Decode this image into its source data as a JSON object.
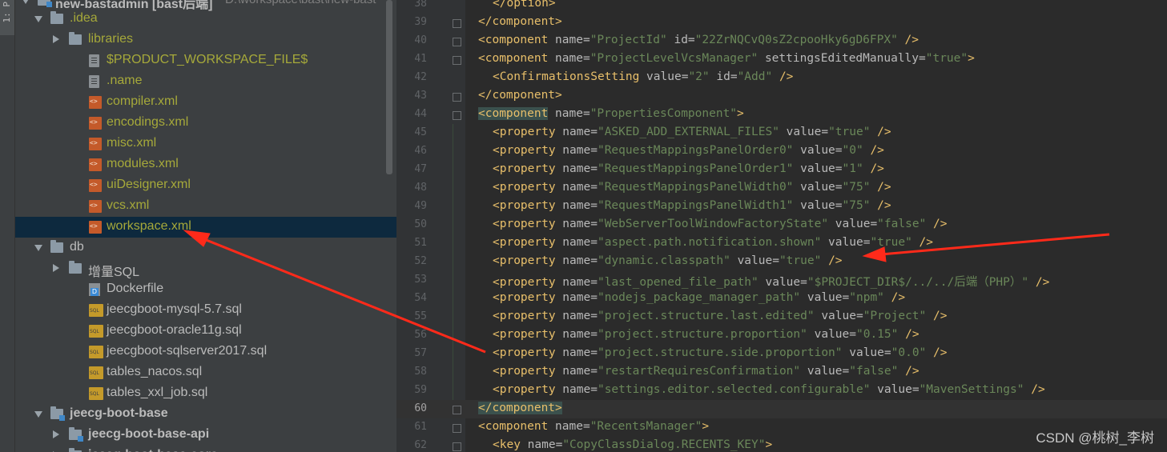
{
  "tool_window_tab": "1: P",
  "project_tree": {
    "root": {
      "label": "new-bastadmin [bast后端]",
      "path": "D:\\workspace\\bast\\new-bast"
    },
    "items": [
      {
        "label": ".idea",
        "kind": "folder",
        "expanded": true,
        "color": "yellow"
      },
      {
        "label": "libraries",
        "kind": "folder",
        "expanded": false,
        "color": "yellow"
      },
      {
        "label": "$PRODUCT_WORKSPACE_FILE$",
        "kind": "text-file",
        "color": "yellow"
      },
      {
        "label": ".name",
        "kind": "text-file",
        "color": "yellow"
      },
      {
        "label": "compiler.xml",
        "kind": "xml-file",
        "color": "yellow"
      },
      {
        "label": "encodings.xml",
        "kind": "xml-file",
        "color": "yellow"
      },
      {
        "label": "misc.xml",
        "kind": "xml-file",
        "color": "yellow"
      },
      {
        "label": "modules.xml",
        "kind": "xml-file",
        "color": "yellow"
      },
      {
        "label": "uiDesigner.xml",
        "kind": "xml-file",
        "color": "yellow"
      },
      {
        "label": "vcs.xml",
        "kind": "xml-file",
        "color": "yellow"
      },
      {
        "label": "workspace.xml",
        "kind": "xml-file",
        "color": "yellow",
        "selected": true
      },
      {
        "label": "db",
        "kind": "folder",
        "expanded": true,
        "color": "gray"
      },
      {
        "label": "增量SQL",
        "kind": "folder",
        "expanded": false,
        "color": "gray"
      },
      {
        "label": "Dockerfile",
        "kind": "docker-file",
        "color": "gray"
      },
      {
        "label": "jeecgboot-mysql-5.7.sql",
        "kind": "sql-file",
        "color": "gray"
      },
      {
        "label": "jeecgboot-oracle11g.sql",
        "kind": "sql-file",
        "color": "gray"
      },
      {
        "label": "jeecgboot-sqlserver2017.sql",
        "kind": "sql-file",
        "color": "gray"
      },
      {
        "label": "tables_nacos.sql",
        "kind": "sql-file",
        "color": "gray"
      },
      {
        "label": "tables_xxl_job.sql",
        "kind": "sql-file",
        "color": "gray"
      },
      {
        "label": "jeecg-boot-base",
        "kind": "module-folder",
        "expanded": true,
        "color": "bold"
      },
      {
        "label": "jeecg-boot-base-api",
        "kind": "module-folder",
        "expanded": false,
        "color": "bold"
      },
      {
        "label": "jeecg-boot-base-core",
        "kind": "module-folder",
        "expanded": false,
        "color": "bold"
      }
    ]
  },
  "editor": {
    "current_line": 60,
    "lines": [
      {
        "n": 38,
        "indent": 2,
        "tokens": [
          [
            "t",
            "</option>"
          ]
        ]
      },
      {
        "n": 39,
        "indent": 0,
        "tokens": [
          [
            "t",
            "</component>"
          ]
        ]
      },
      {
        "n": 40,
        "indent": 0,
        "tokens": [
          [
            "t",
            "<component"
          ],
          [
            "a",
            " name="
          ],
          [
            "v",
            "\"ProjectId\""
          ],
          [
            "a",
            " id="
          ],
          [
            "v",
            "\"22ZrNQCvQ0sZ2cpooHky6gD6FPX\""
          ],
          [
            "t",
            " />"
          ]
        ]
      },
      {
        "n": 41,
        "indent": 0,
        "tokens": [
          [
            "t",
            "<component"
          ],
          [
            "a",
            " name="
          ],
          [
            "v",
            "\"ProjectLevelVcsManager\""
          ],
          [
            "a",
            " settingsEditedManually="
          ],
          [
            "v",
            "\"true\""
          ],
          [
            "t",
            ">"
          ]
        ]
      },
      {
        "n": 42,
        "indent": 2,
        "tokens": [
          [
            "t",
            "<ConfirmationsSetting"
          ],
          [
            "a",
            " value="
          ],
          [
            "v",
            "\"2\""
          ],
          [
            "a",
            " id="
          ],
          [
            "v",
            "\"Add\""
          ],
          [
            "t",
            " />"
          ]
        ]
      },
      {
        "n": 43,
        "indent": 0,
        "tokens": [
          [
            "t",
            "</component>"
          ]
        ]
      },
      {
        "n": 44,
        "indent": 0,
        "tokens": [
          [
            "th",
            "<component"
          ],
          [
            "a",
            " name="
          ],
          [
            "v",
            "\"PropertiesComponent\""
          ],
          [
            "t",
            ">"
          ]
        ]
      },
      {
        "n": 45,
        "indent": 2,
        "tokens": [
          [
            "t",
            "<property"
          ],
          [
            "a",
            " name="
          ],
          [
            "v",
            "\"ASKED_ADD_EXTERNAL_FILES\""
          ],
          [
            "a",
            " value="
          ],
          [
            "v",
            "\"true\""
          ],
          [
            "t",
            " />"
          ]
        ]
      },
      {
        "n": 46,
        "indent": 2,
        "tokens": [
          [
            "t",
            "<property"
          ],
          [
            "a",
            " name="
          ],
          [
            "v",
            "\"RequestMappingsPanelOrder0\""
          ],
          [
            "a",
            " value="
          ],
          [
            "v",
            "\"0\""
          ],
          [
            "t",
            " />"
          ]
        ]
      },
      {
        "n": 47,
        "indent": 2,
        "tokens": [
          [
            "t",
            "<property"
          ],
          [
            "a",
            " name="
          ],
          [
            "v",
            "\"RequestMappingsPanelOrder1\""
          ],
          [
            "a",
            " value="
          ],
          [
            "v",
            "\"1\""
          ],
          [
            "t",
            " />"
          ]
        ]
      },
      {
        "n": 48,
        "indent": 2,
        "tokens": [
          [
            "t",
            "<property"
          ],
          [
            "a",
            " name="
          ],
          [
            "v",
            "\"RequestMappingsPanelWidth0\""
          ],
          [
            "a",
            " value="
          ],
          [
            "v",
            "\"75\""
          ],
          [
            "t",
            " />"
          ]
        ]
      },
      {
        "n": 49,
        "indent": 2,
        "tokens": [
          [
            "t",
            "<property"
          ],
          [
            "a",
            " name="
          ],
          [
            "v",
            "\"RequestMappingsPanelWidth1\""
          ],
          [
            "a",
            " value="
          ],
          [
            "v",
            "\"75\""
          ],
          [
            "t",
            " />"
          ]
        ]
      },
      {
        "n": 50,
        "indent": 2,
        "tokens": [
          [
            "t",
            "<property"
          ],
          [
            "a",
            " name="
          ],
          [
            "v",
            "\"WebServerToolWindowFactoryState\""
          ],
          [
            "a",
            " value="
          ],
          [
            "v",
            "\"false\""
          ],
          [
            "t",
            " />"
          ]
        ]
      },
      {
        "n": 51,
        "indent": 2,
        "tokens": [
          [
            "t",
            "<property"
          ],
          [
            "a",
            " name="
          ],
          [
            "v",
            "\"aspect.path.notification.shown\""
          ],
          [
            "a",
            " value="
          ],
          [
            "v",
            "\"true\""
          ],
          [
            "t",
            " />"
          ]
        ]
      },
      {
        "n": 52,
        "indent": 2,
        "tokens": [
          [
            "t",
            "<property"
          ],
          [
            "a",
            " name="
          ],
          [
            "v",
            "\"dynamic.classpath\""
          ],
          [
            "a",
            " value="
          ],
          [
            "v",
            "\"true\""
          ],
          [
            "t",
            " />"
          ]
        ]
      },
      {
        "n": 53,
        "indent": 2,
        "tokens": [
          [
            "t",
            "<property"
          ],
          [
            "a",
            " name="
          ],
          [
            "v",
            "\"last_opened_file_path\""
          ],
          [
            "a",
            " value="
          ],
          [
            "v",
            "\"$PROJECT_DIR$/../../后端（PHP）\""
          ],
          [
            "t",
            " />"
          ]
        ]
      },
      {
        "n": 54,
        "indent": 2,
        "tokens": [
          [
            "t",
            "<property"
          ],
          [
            "a",
            " name="
          ],
          [
            "v",
            "\"nodejs_package_manager_path\""
          ],
          [
            "a",
            " value="
          ],
          [
            "v",
            "\"npm\""
          ],
          [
            "t",
            " />"
          ]
        ]
      },
      {
        "n": 55,
        "indent": 2,
        "tokens": [
          [
            "t",
            "<property"
          ],
          [
            "a",
            " name="
          ],
          [
            "v",
            "\"project.structure.last.edited\""
          ],
          [
            "a",
            " value="
          ],
          [
            "v",
            "\"Project\""
          ],
          [
            "t",
            " />"
          ]
        ]
      },
      {
        "n": 56,
        "indent": 2,
        "tokens": [
          [
            "t",
            "<property"
          ],
          [
            "a",
            " name="
          ],
          [
            "v",
            "\"project.structure.proportion\""
          ],
          [
            "a",
            " value="
          ],
          [
            "v",
            "\"0.15\""
          ],
          [
            "t",
            " />"
          ]
        ]
      },
      {
        "n": 57,
        "indent": 2,
        "tokens": [
          [
            "t",
            "<property"
          ],
          [
            "a",
            " name="
          ],
          [
            "v",
            "\"project.structure.side.proportion\""
          ],
          [
            "a",
            " value="
          ],
          [
            "v",
            "\"0.0\""
          ],
          [
            "t",
            " />"
          ]
        ]
      },
      {
        "n": 58,
        "indent": 2,
        "tokens": [
          [
            "t",
            "<property"
          ],
          [
            "a",
            " name="
          ],
          [
            "v",
            "\"restartRequiresConfirmation\""
          ],
          [
            "a",
            " value="
          ],
          [
            "v",
            "\"false\""
          ],
          [
            "t",
            " />"
          ]
        ]
      },
      {
        "n": 59,
        "indent": 2,
        "tokens": [
          [
            "t",
            "<property"
          ],
          [
            "a",
            " name="
          ],
          [
            "v",
            "\"settings.editor.selected.configurable\""
          ],
          [
            "a",
            " value="
          ],
          [
            "v",
            "\"MavenSettings\""
          ],
          [
            "t",
            " />"
          ]
        ]
      },
      {
        "n": 60,
        "indent": 0,
        "tokens": [
          [
            "th",
            "</component>"
          ]
        ]
      },
      {
        "n": 61,
        "indent": 0,
        "tokens": [
          [
            "t",
            "<component"
          ],
          [
            "a",
            " name="
          ],
          [
            "v",
            "\"RecentsManager\""
          ],
          [
            "t",
            ">"
          ]
        ]
      },
      {
        "n": 62,
        "indent": 2,
        "tokens": [
          [
            "t",
            "<key"
          ],
          [
            "a",
            " name="
          ],
          [
            "v",
            "\"CopyClassDialog.RECENTS_KEY\""
          ],
          [
            "t",
            ">"
          ]
        ]
      }
    ]
  },
  "browser_icons": [
    "chrome-icon",
    "firefox-icon",
    "safari-icon"
  ],
  "watermark": "CSDN @桃树_李树",
  "colors": {
    "tag": "#e8bf6a",
    "attr": "#bababa",
    "value": "#6a8759",
    "selected_row": "#0d293e",
    "annotation_arrow": "#ff2a1a"
  }
}
